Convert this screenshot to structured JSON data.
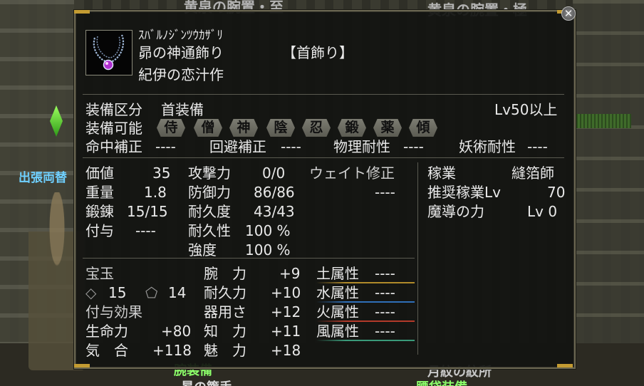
{
  "background": {
    "top_left_label": "黄泉の腕置・至",
    "top_right_label": "黄泉の腕置・極",
    "left_label": "出張両替",
    "bottom_label_1": "腕装備",
    "bottom_label_2": "月紋の紋所",
    "bottom_label_3": "昴の籠手",
    "bottom_label_4": "腰袋装備"
  },
  "item": {
    "reading": "ｽﾊﾞﾙﾉｼﾞﾝﾂｳｶｻﾞﾘ",
    "name": "昴の神通飾り",
    "category": "【首飾り】",
    "maker": "紀伊の恋汁作"
  },
  "equip": {
    "slot_label": "装備区分",
    "slot_value": "首装備",
    "level_req": "Lv50以上",
    "usable_label": "装備可能",
    "classes": [
      "侍",
      "僧",
      "神",
      "陰",
      "忍",
      "鍛",
      "薬",
      "傾"
    ]
  },
  "resist": {
    "hit_label": "命中補正",
    "hit_value": "----",
    "evade_label": "回避補正",
    "evade_value": "----",
    "phys_label": "物理耐性",
    "phys_value": "----",
    "magic_label": "妖術耐性",
    "magic_value": "----"
  },
  "stats": {
    "price_label": "価値",
    "price_value": "35",
    "weight_label": "重量",
    "weight_value": "1.8",
    "forge_label": "鍛錬",
    "forge_value": "15/15",
    "grant_label": "付与",
    "grant_value": "----",
    "attack_label": "攻撃力",
    "attack_value": "0/0",
    "defense_label": "防御力",
    "defense_value": "86/86",
    "durability_label": "耐久度",
    "durability_value": "43/43",
    "durable_trait_label": "耐久性",
    "durable_trait_value": "100 %",
    "strength_label": "強度",
    "strength_value": "100 %",
    "weight_mod_label": "ウェイト修正",
    "weight_mod_value": "----"
  },
  "job": {
    "job_label": "稼業",
    "job_value": "縫箔師",
    "rec_label": "推奨稼業Lv",
    "rec_value": "70",
    "magic_power_label": "魔導の力",
    "magic_power_value": "Lv 0"
  },
  "gems": {
    "label": "宝玉",
    "slot1": "15",
    "slot2": "14",
    "effects_label": "付与効果"
  },
  "bonuses": [
    {
      "label": "生命力",
      "value": "+80"
    },
    {
      "label": "気　合",
      "value": "+118"
    }
  ],
  "attributes": [
    {
      "label": "腕　力",
      "value": "+9"
    },
    {
      "label": "耐久力",
      "value": "+10"
    },
    {
      "label": "器用さ",
      "value": "+12"
    },
    {
      "label": "知　力",
      "value": "+11"
    },
    {
      "label": "魅　力",
      "value": "+18"
    }
  ],
  "elements": [
    {
      "label": "土属性",
      "value": "----",
      "color": "#b08a2a"
    },
    {
      "label": "水属性",
      "value": "----",
      "color": "#2f6fb8"
    },
    {
      "label": "火属性",
      "value": "----",
      "color": "#b33a2a"
    },
    {
      "label": "風属性",
      "value": "----",
      "color": "#3a9a7a"
    }
  ],
  "close_glyph": "✕"
}
